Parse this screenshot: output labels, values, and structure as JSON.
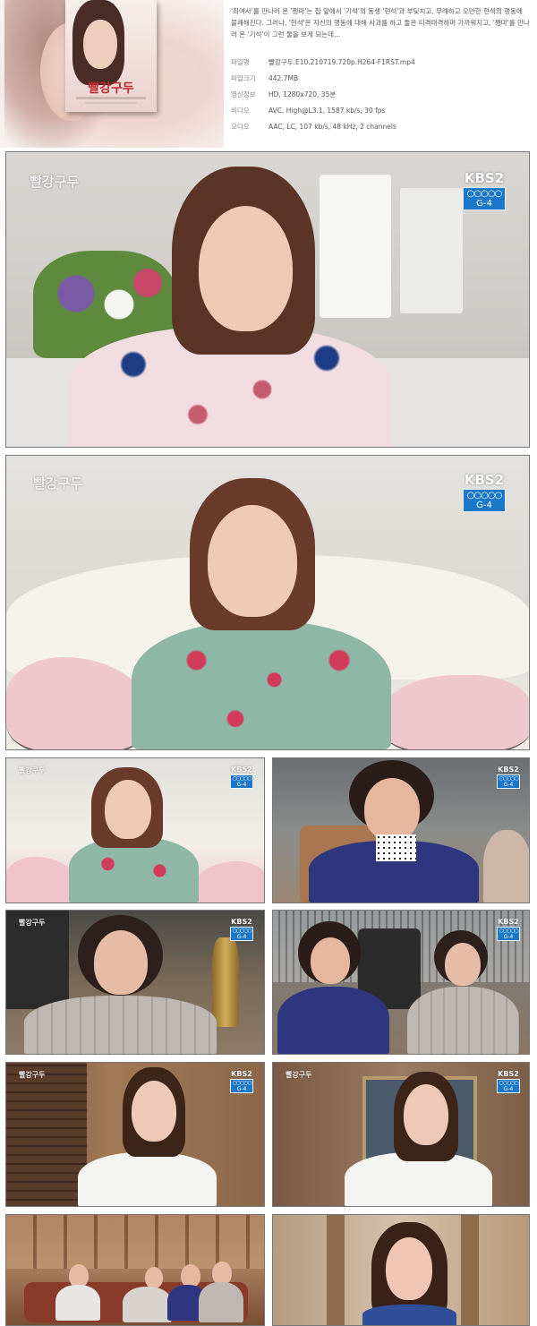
{
  "header": {
    "poster_title": "빨강구두",
    "synopsis": "'최여사'를 만나러 온 '쩡마'는 집 앞에서 '기석'의 동생 '현석'과 부딪치고, 무례하고 오만한 현석의 행동에 불쾌해진다. 그러나, '현석'은 자신의 행동에 대해 사과를 하고 둘은 티격태격하며 가까워지고, '쩡마'를 만나러 온 '기석'이 그런 둘을 보게 되는데...",
    "info": [
      {
        "label": "파일명",
        "value": "빨강구두.E10.210719.720p.H264-F1RST.mp4"
      },
      {
        "label": "파일크기",
        "value": "442.7MB"
      },
      {
        "label": "영상정보",
        "value": "HD, 1280x720, 35분"
      },
      {
        "label": "비디오",
        "value": "AVC, High@L3.1, 1587 kb/s, 30 fps"
      },
      {
        "label": "오디오",
        "value": "AAC, LC, 107 kb/s, 48 kHz, 2 channels"
      }
    ]
  },
  "frames": {
    "watermark": "빨강구두",
    "channel": "KBS",
    "channel_num": "2",
    "rating": "G-4",
    "rings": "○○○○○"
  },
  "colors": {
    "badge_blue": "#1b78c8",
    "link_red": "#c0282f"
  }
}
